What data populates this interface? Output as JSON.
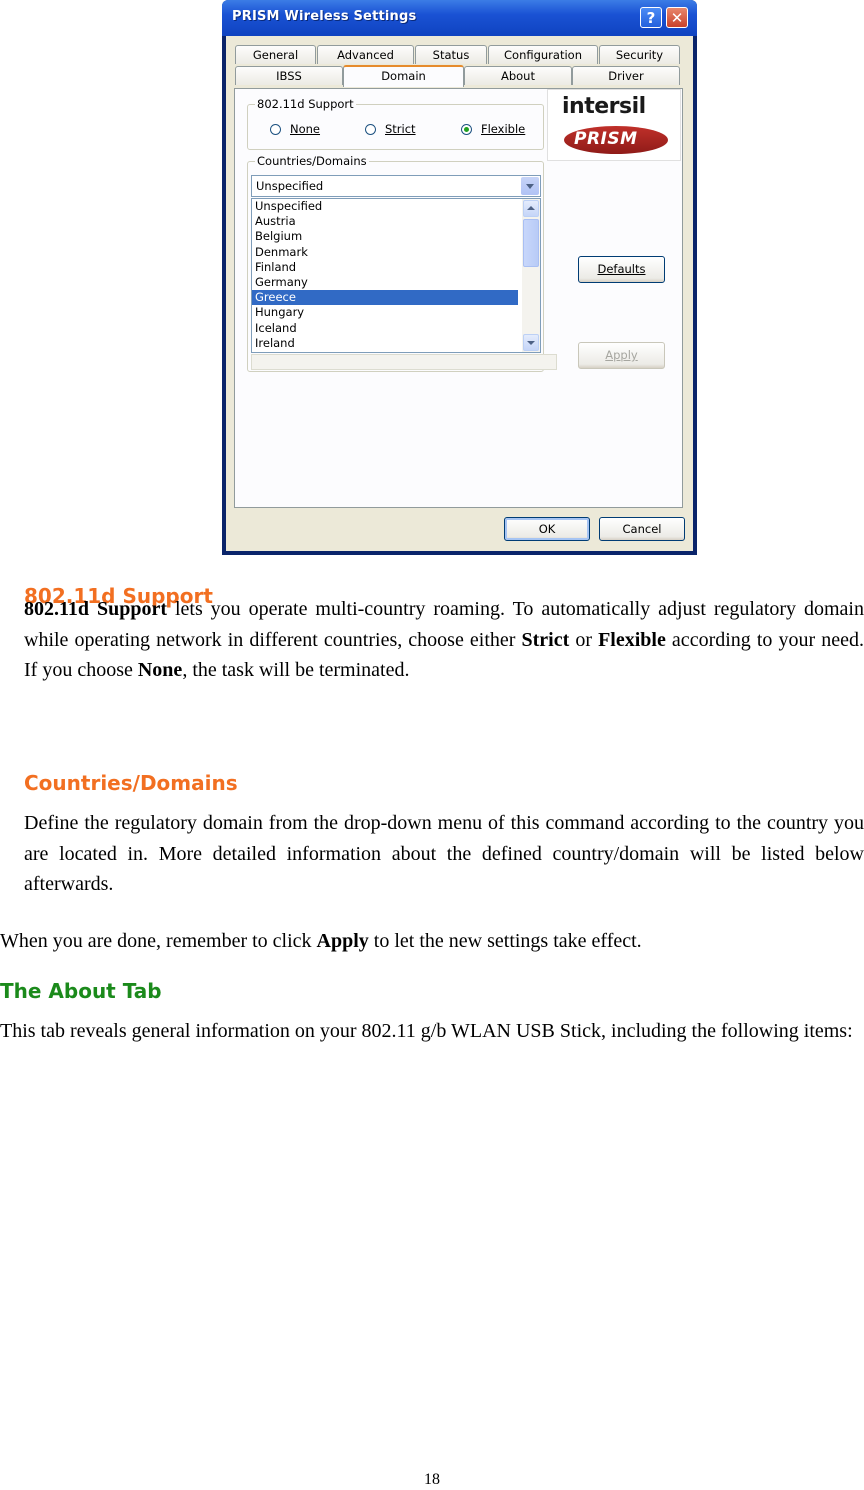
{
  "dialog": {
    "title": "PRISM Wireless Settings",
    "help_glyph": "?",
    "close_glyph": "✕",
    "tabs_row1": [
      "General",
      "Advanced",
      "Status",
      "Configuration",
      "Security"
    ],
    "tabs_row2": [
      "IBSS",
      "Domain",
      "About",
      "Driver"
    ],
    "active_tab": "Domain",
    "support_group": {
      "label": "802.11d Support",
      "options": [
        {
          "label": "None",
          "selected": false
        },
        {
          "label": "Strict",
          "selected": false
        },
        {
          "label": "Flexible",
          "selected": true
        }
      ]
    },
    "countries_group": {
      "label": "Countries/Domains",
      "combo_value": "Unspecified",
      "list_items": [
        "Unspecified",
        "Austria",
        "Belgium",
        "Denmark",
        "Finland",
        "Germany",
        "Greece",
        "Hungary",
        "Iceland",
        "Ireland"
      ],
      "selected_item": "Greece"
    },
    "logo": {
      "brand1": "intersil",
      "brand2": "PRISM"
    },
    "buttons": {
      "defaults": "Defaults",
      "apply": "Apply",
      "ok": "OK",
      "cancel": "Cancel"
    }
  },
  "doc": {
    "heading_support": "802.11d Support",
    "support_p": {
      "b1": "802.11d Support",
      "t1": " lets you operate multi-country roaming. To automatically adjust regulatory domain while operating network in different countries, choose either ",
      "b2": "Strict",
      "t2": " or ",
      "b3": "Flexible",
      "t3": " according to your need. If you choose ",
      "b4": "None",
      "t4": ", the task will be terminated."
    },
    "heading_countries": "Countries/Domains",
    "countries_p": "Define the regulatory domain from the drop-down menu of this command according to the country you are located in. More detailed information about the defined country/domain will be listed below afterwards.",
    "apply_p": {
      "t1": "When you are done, remember to click ",
      "b1": "Apply",
      "t2": " to let the new settings take effect."
    },
    "heading_about": "The About Tab",
    "about_p": "This tab reveals general information on your 802.11 g/b WLAN USB Stick, including the following items:",
    "page_number": "18"
  }
}
